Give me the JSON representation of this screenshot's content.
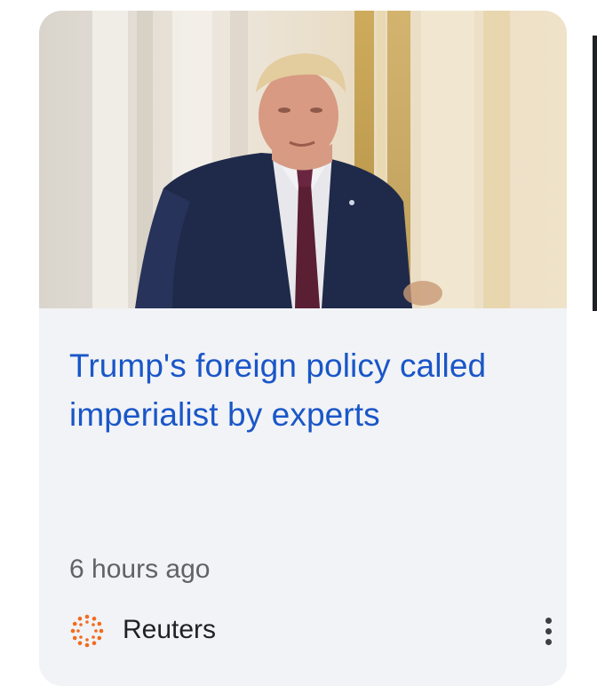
{
  "card": {
    "headline": "Trump's foreign policy called imperialist by experts",
    "timestamp": "6 hours ago",
    "source": {
      "name": "Reuters",
      "logo_icon": "reuters-logo-icon",
      "logo_color": "#f26b1d"
    },
    "more_icon": "more-vert-icon"
  },
  "colors": {
    "headline": "#1a56c8",
    "card_background": "#f1f3f6",
    "meta_text": "#5f6368"
  }
}
